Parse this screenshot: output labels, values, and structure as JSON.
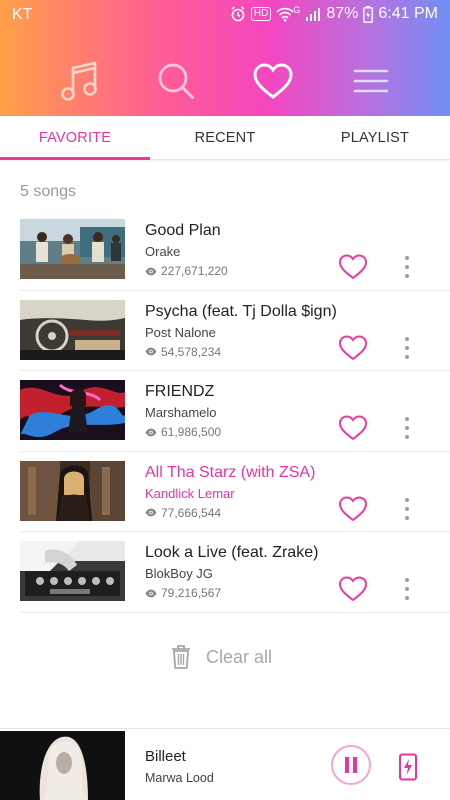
{
  "status_bar": {
    "carrier": "KT",
    "badge_hd": "HD",
    "badge_g": "G",
    "battery": "87%",
    "time": "6:41 PM"
  },
  "top_nav": {
    "icons": [
      "music-note-icon",
      "search-icon",
      "heart-icon",
      "menu-icon"
    ],
    "active": "heart-icon"
  },
  "tabs": [
    {
      "label": "FAVORITE",
      "active": true
    },
    {
      "label": "RECENT",
      "active": false
    },
    {
      "label": "PLAYLIST",
      "active": false
    }
  ],
  "song_count": "5 songs",
  "songs": [
    {
      "title": "Good Plan",
      "artist": "Orake",
      "views": "227,671,220",
      "playing": false
    },
    {
      "title": "Psycha (feat. Tj Dolla $ign)",
      "artist": "Post Nalone",
      "views": "54,578,234",
      "playing": false
    },
    {
      "title": "FRIENDZ",
      "artist": "Marshamelo",
      "views": "61,986,500",
      "playing": false
    },
    {
      "title": "All Tha Starz (with ZSA)",
      "artist": "Kandlick Lemar",
      "views": "77,666,544",
      "playing": true
    },
    {
      "title": "Look a Live (feat. Zrake)",
      "artist": "BlokBoy JG",
      "views": "79,216,567",
      "playing": false
    }
  ],
  "clear_all": "Clear all",
  "mini_player": {
    "title": "Billeet",
    "artist": "Marwa Lood"
  },
  "colors": {
    "accent": "#e833a7",
    "heart": "#f0389f",
    "gradient_start": "#ffa048",
    "gradient_mid": "#f446c0",
    "gradient_end": "#6f8ff3"
  }
}
